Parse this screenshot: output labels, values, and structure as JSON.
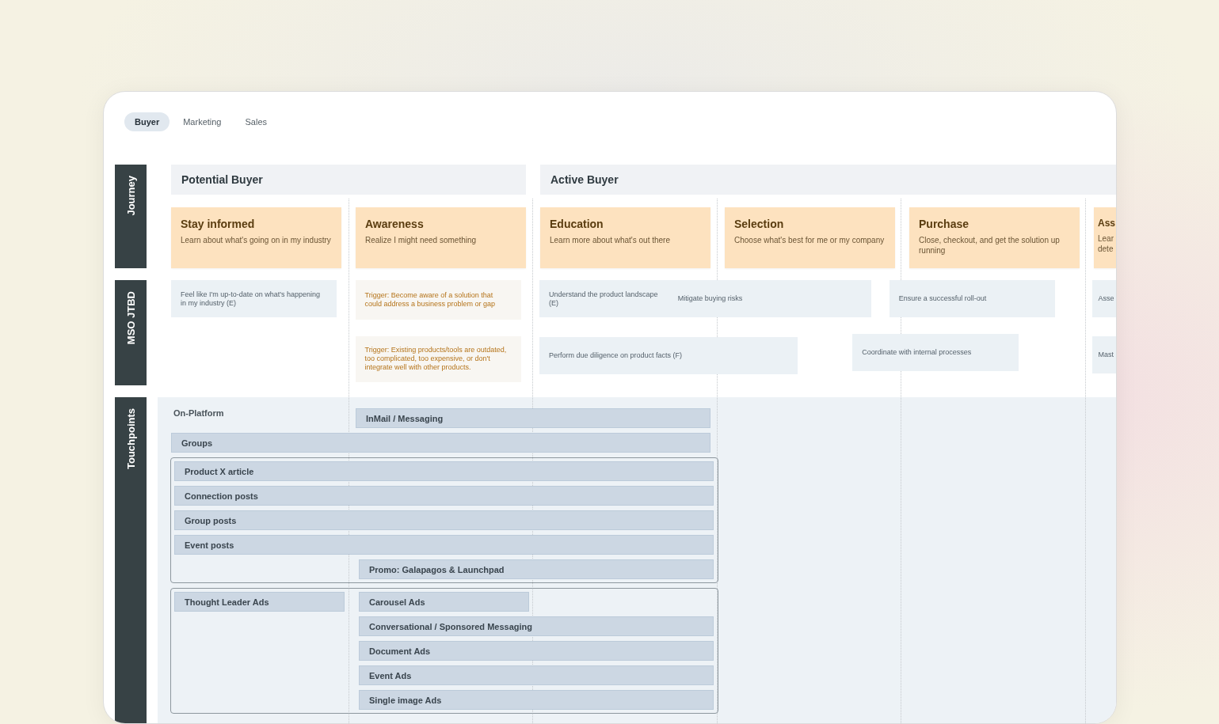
{
  "tabs": [
    {
      "label": "Buyer",
      "selected": true
    },
    {
      "label": "Marketing",
      "selected": false
    },
    {
      "label": "Sales",
      "selected": false
    }
  ],
  "journey": {
    "label": "Journey",
    "phases": [
      {
        "title": "Potential Buyer"
      },
      {
        "title": "Active Buyer"
      }
    ],
    "stages": [
      {
        "title": "Stay informed",
        "description": "Learn about what's going on in my industry"
      },
      {
        "title": "Awareness",
        "description": "Realize I might need something"
      },
      {
        "title": "Education",
        "description": "Learn more about what's out there"
      },
      {
        "title": "Selection",
        "description": "Choose what's best for me or my company"
      },
      {
        "title": "Purchase",
        "description": "Close, checkout, and get the solution up running"
      },
      {
        "title": "Ass",
        "description": "Lear\ndete"
      }
    ]
  },
  "jtbd": {
    "label": "MSO JTBD",
    "items": [
      {
        "kind": "need",
        "text": "Feel like I'm up-to-date on what's happening in my industry (E)"
      },
      {
        "kind": "trigger",
        "text": "Trigger: Become aware of a solution that could address a business problem or gap"
      },
      {
        "kind": "need",
        "text": "Understand the product landscape (E)"
      },
      {
        "kind": "need",
        "text": "Mitigate buying risks"
      },
      {
        "kind": "need",
        "text": "Ensure a successful roll-out"
      },
      {
        "kind": "need",
        "text": "Asse"
      },
      {
        "kind": "trigger",
        "text": "Trigger:  Existing products/tools are outdated, too complicated, too expensive, or don't integrate well with other products."
      },
      {
        "kind": "need",
        "text": "Perform due diligence on product facts (F)"
      },
      {
        "kind": "need",
        "text": "Coordinate with internal processes"
      },
      {
        "kind": "need",
        "text": "Mast"
      }
    ]
  },
  "touchpoints": {
    "label": "Touchpoints",
    "group_label": "On-Platform",
    "groups": [
      {
        "framed": false,
        "items": [
          "InMail / Messaging",
          "Groups"
        ]
      },
      {
        "framed": true,
        "items": [
          "Product X article",
          "Connection posts",
          "Group posts",
          "Event posts",
          "Promo: Galapagos & Launchpad"
        ]
      },
      {
        "framed": true,
        "items": [
          "Thought Leader Ads",
          "Carousel Ads",
          "Conversational / Sponsored Messaging",
          "Document Ads",
          "Event Ads",
          "Single image Ads"
        ]
      }
    ]
  }
}
